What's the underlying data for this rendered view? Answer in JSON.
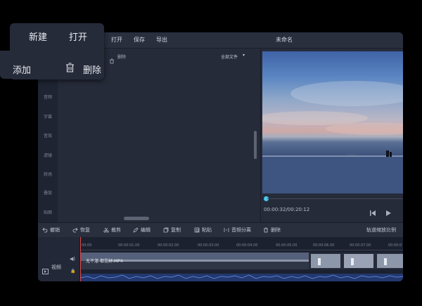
{
  "menu": {
    "open": "打开",
    "save": "保存",
    "export": "导出"
  },
  "window_title": "未命名",
  "popup": {
    "new": "新建",
    "open": "打开",
    "add": "添加",
    "delete": "删除"
  },
  "media_toolbar": {
    "delete": "删除",
    "filter": "全部文件"
  },
  "left_nav": [
    "音频",
    "字幕",
    "音效",
    "滤镜",
    "转场",
    "叠层",
    "贴图"
  ],
  "preview": {
    "time": "00:00:32/00:20:12"
  },
  "edit_tools": {
    "undo": "撤销",
    "redo": "恢复",
    "cut": "裁剪",
    "edit": "编辑",
    "copy": "复制",
    "paste": "粘贴",
    "audio_split": "音频分离",
    "delete": "删除",
    "zoom": "轨道缩放比例"
  },
  "timeline": {
    "ticks": [
      "00:00",
      "00:00:01.00",
      "00:00:02.00",
      "00:00:03.00",
      "00:00:04.00",
      "00:00:05.00",
      "00:00:06.00",
      "00:00:07.00",
      "00:00:0"
    ],
    "track_label": "视频",
    "clip_name": "无不溜-都挺好.MP4",
    "playhead_position": 0
  },
  "colors": {
    "background": "#000000",
    "panel": "#232838",
    "accent": "#4cc8f0",
    "playhead": "#e24a4a",
    "audio": "#22386e"
  }
}
